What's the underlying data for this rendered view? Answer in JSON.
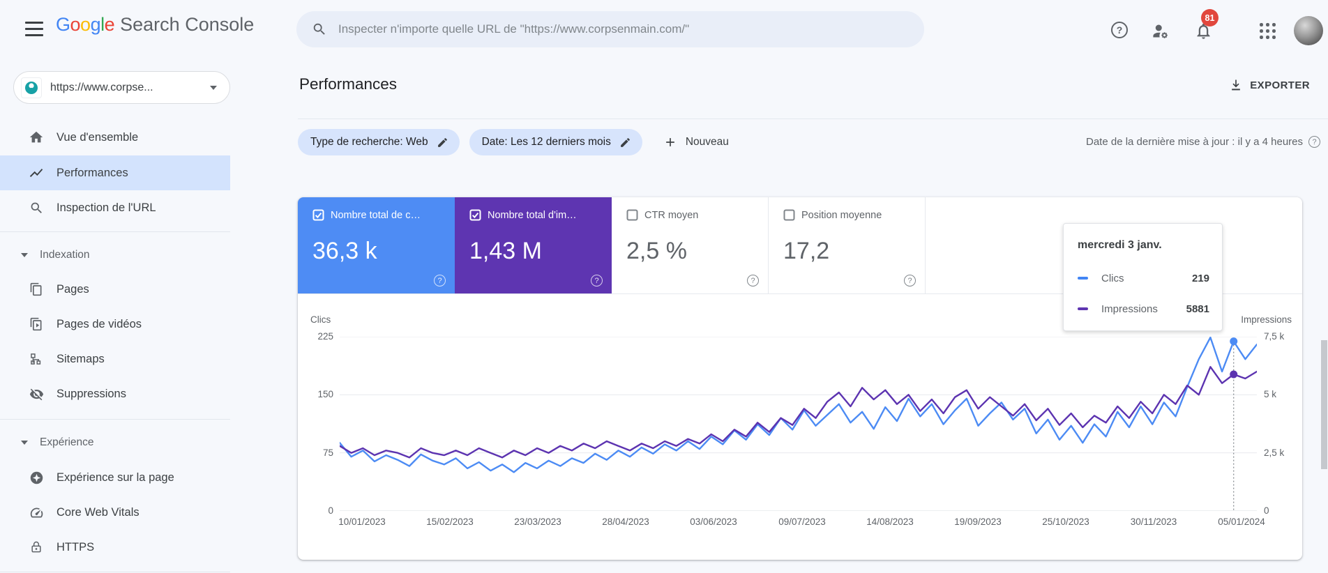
{
  "topbar": {
    "logo": {
      "letters": [
        "G",
        "o",
        "o",
        "g",
        "l",
        "e"
      ],
      "product": "Search Console"
    },
    "search_placeholder": "Inspecter n'importe quelle URL de \"https://www.corpsenmain.com/\"",
    "notification_count": "81",
    "help_glyph": "?"
  },
  "sidebar": {
    "property_selector": "https://www.corpse...",
    "primary": [
      {
        "label": "Vue d'ensemble"
      },
      {
        "label": "Performances"
      },
      {
        "label": "Inspection de l'URL"
      }
    ],
    "sections": [
      {
        "title": "Indexation",
        "items": [
          {
            "label": "Pages"
          },
          {
            "label": "Pages de vidéos"
          },
          {
            "label": "Sitemaps"
          },
          {
            "label": "Suppressions"
          }
        ]
      },
      {
        "title": "Expérience",
        "items": [
          {
            "label": "Expérience sur la page"
          },
          {
            "label": "Core Web Vitals"
          },
          {
            "label": "HTTPS"
          }
        ]
      }
    ]
  },
  "main": {
    "title": "Performances",
    "export_label": "EXPORTER",
    "filters": [
      {
        "label": "Type de recherche: Web"
      },
      {
        "label": "Date: Les 12 derniers mois"
      }
    ],
    "new_filter_label": "Nouveau",
    "last_update": "Date de la dernière mise à jour : il y a 4 heures",
    "metrics": [
      {
        "label": "Nombre total de c…",
        "value": "36,3 k",
        "checked": true,
        "color": "#4e8cf4"
      },
      {
        "label": "Nombre total d'im…",
        "value": "1,43 M",
        "checked": true,
        "color": "#5e35b1"
      },
      {
        "label": "CTR moyen",
        "value": "2,5 %",
        "checked": false,
        "color": "#ffffff"
      },
      {
        "label": "Position moyenne",
        "value": "17,2",
        "checked": false,
        "color": "#ffffff"
      }
    ],
    "tooltip": {
      "date": "mercredi 3 janv.",
      "rows": [
        {
          "label": "Clics",
          "value": "219",
          "color": "#4285f4"
        },
        {
          "label": "Impressions",
          "value": "5881",
          "color": "#5e35b1"
        }
      ]
    }
  },
  "chart_data": {
    "type": "line",
    "title": "Performances - Clics et Impressions (12 derniers mois)",
    "legend_position": "none",
    "grid": true,
    "x_ticks": [
      "10/01/2023",
      "15/02/2023",
      "23/03/2023",
      "28/04/2023",
      "03/06/2023",
      "09/07/2023",
      "14/08/2023",
      "19/09/2023",
      "25/10/2023",
      "30/11/2023",
      "05/01/2024"
    ],
    "left_axis": {
      "label": "Clics",
      "ticks": [
        "225",
        "150",
        "75",
        "0"
      ],
      "tick_values": [
        225,
        150,
        75,
        0
      ],
      "max": 225
    },
    "right_axis": {
      "label": "Impressions",
      "ticks": [
        "7,5 k",
        "5 k",
        "2,5 k",
        "0"
      ],
      "tick_values": [
        7500,
        5000,
        2500,
        0
      ],
      "max": 7500
    },
    "series": [
      {
        "name": "Clics",
        "axis": "left",
        "color": "#4c8bf4",
        "values": [
          88,
          70,
          78,
          64,
          72,
          66,
          58,
          73,
          65,
          60,
          68,
          55,
          63,
          52,
          60,
          50,
          62,
          55,
          65,
          58,
          68,
          62,
          74,
          66,
          78,
          70,
          82,
          74,
          86,
          78,
          90,
          80,
          96,
          86,
          104,
          92,
          112,
          98,
          120,
          105,
          130,
          110,
          124,
          138,
          114,
          128,
          106,
          134,
          116,
          145,
          122,
          138,
          112,
          130,
          145,
          110,
          126,
          140,
          118,
          132,
          100,
          118,
          92,
          110,
          88,
          112,
          96,
          128,
          108,
          135,
          112,
          140,
          122,
          160,
          196,
          224,
          180,
          219,
          196,
          215
        ]
      },
      {
        "name": "Impressions",
        "axis": "right",
        "color": "#5c33b0",
        "values": [
          2800,
          2500,
          2700,
          2400,
          2600,
          2500,
          2300,
          2700,
          2500,
          2400,
          2600,
          2400,
          2700,
          2500,
          2300,
          2600,
          2400,
          2700,
          2500,
          2800,
          2600,
          2900,
          2700,
          3000,
          2800,
          2600,
          2900,
          2700,
          3000,
          2800,
          3100,
          2900,
          3300,
          3000,
          3500,
          3200,
          3800,
          3400,
          4000,
          3700,
          4400,
          4000,
          4700,
          5100,
          4500,
          5300,
          4800,
          5200,
          4600,
          5000,
          4300,
          4800,
          4200,
          4900,
          5200,
          4400,
          4900,
          4500,
          4100,
          4600,
          3900,
          4400,
          3700,
          4200,
          3600,
          4100,
          3800,
          4500,
          4000,
          4700,
          4200,
          5000,
          4600,
          5400,
          5000,
          6200,
          5500,
          5881,
          5700,
          6000
        ]
      }
    ],
    "hover": {
      "x_fraction": 0.9747,
      "date_label": "mercredi 3 janv.",
      "clics": 219,
      "impressions": 5881
    }
  }
}
